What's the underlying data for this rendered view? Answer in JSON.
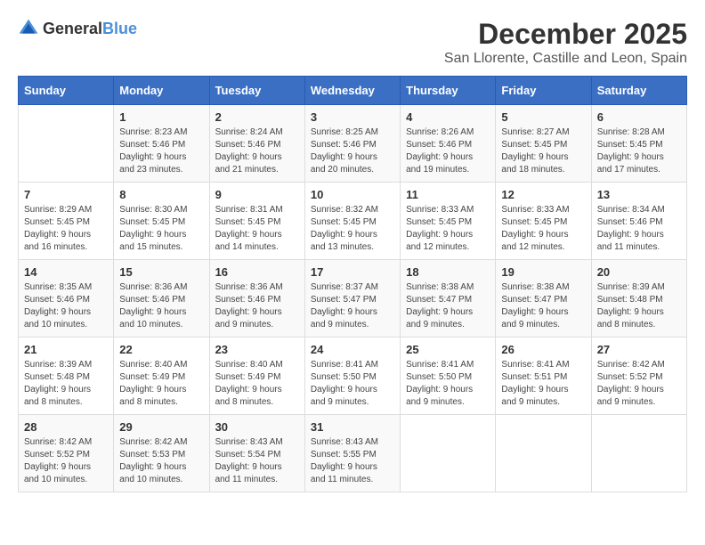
{
  "header": {
    "logo_general": "General",
    "logo_blue": "Blue",
    "month": "December 2025",
    "location": "San Llorente, Castille and Leon, Spain"
  },
  "calendar": {
    "days_of_week": [
      "Sunday",
      "Monday",
      "Tuesday",
      "Wednesday",
      "Thursday",
      "Friday",
      "Saturday"
    ],
    "weeks": [
      [
        {
          "day": "",
          "info": ""
        },
        {
          "day": "1",
          "info": "Sunrise: 8:23 AM\nSunset: 5:46 PM\nDaylight: 9 hours\nand 23 minutes."
        },
        {
          "day": "2",
          "info": "Sunrise: 8:24 AM\nSunset: 5:46 PM\nDaylight: 9 hours\nand 21 minutes."
        },
        {
          "day": "3",
          "info": "Sunrise: 8:25 AM\nSunset: 5:46 PM\nDaylight: 9 hours\nand 20 minutes."
        },
        {
          "day": "4",
          "info": "Sunrise: 8:26 AM\nSunset: 5:46 PM\nDaylight: 9 hours\nand 19 minutes."
        },
        {
          "day": "5",
          "info": "Sunrise: 8:27 AM\nSunset: 5:45 PM\nDaylight: 9 hours\nand 18 minutes."
        },
        {
          "day": "6",
          "info": "Sunrise: 8:28 AM\nSunset: 5:45 PM\nDaylight: 9 hours\nand 17 minutes."
        }
      ],
      [
        {
          "day": "7",
          "info": "Sunrise: 8:29 AM\nSunset: 5:45 PM\nDaylight: 9 hours\nand 16 minutes."
        },
        {
          "day": "8",
          "info": "Sunrise: 8:30 AM\nSunset: 5:45 PM\nDaylight: 9 hours\nand 15 minutes."
        },
        {
          "day": "9",
          "info": "Sunrise: 8:31 AM\nSunset: 5:45 PM\nDaylight: 9 hours\nand 14 minutes."
        },
        {
          "day": "10",
          "info": "Sunrise: 8:32 AM\nSunset: 5:45 PM\nDaylight: 9 hours\nand 13 minutes."
        },
        {
          "day": "11",
          "info": "Sunrise: 8:33 AM\nSunset: 5:45 PM\nDaylight: 9 hours\nand 12 minutes."
        },
        {
          "day": "12",
          "info": "Sunrise: 8:33 AM\nSunset: 5:45 PM\nDaylight: 9 hours\nand 12 minutes."
        },
        {
          "day": "13",
          "info": "Sunrise: 8:34 AM\nSunset: 5:46 PM\nDaylight: 9 hours\nand 11 minutes."
        }
      ],
      [
        {
          "day": "14",
          "info": "Sunrise: 8:35 AM\nSunset: 5:46 PM\nDaylight: 9 hours\nand 10 minutes."
        },
        {
          "day": "15",
          "info": "Sunrise: 8:36 AM\nSunset: 5:46 PM\nDaylight: 9 hours\nand 10 minutes."
        },
        {
          "day": "16",
          "info": "Sunrise: 8:36 AM\nSunset: 5:46 PM\nDaylight: 9 hours\nand 9 minutes."
        },
        {
          "day": "17",
          "info": "Sunrise: 8:37 AM\nSunset: 5:47 PM\nDaylight: 9 hours\nand 9 minutes."
        },
        {
          "day": "18",
          "info": "Sunrise: 8:38 AM\nSunset: 5:47 PM\nDaylight: 9 hours\nand 9 minutes."
        },
        {
          "day": "19",
          "info": "Sunrise: 8:38 AM\nSunset: 5:47 PM\nDaylight: 9 hours\nand 9 minutes."
        },
        {
          "day": "20",
          "info": "Sunrise: 8:39 AM\nSunset: 5:48 PM\nDaylight: 9 hours\nand 8 minutes."
        }
      ],
      [
        {
          "day": "21",
          "info": "Sunrise: 8:39 AM\nSunset: 5:48 PM\nDaylight: 9 hours\nand 8 minutes."
        },
        {
          "day": "22",
          "info": "Sunrise: 8:40 AM\nSunset: 5:49 PM\nDaylight: 9 hours\nand 8 minutes."
        },
        {
          "day": "23",
          "info": "Sunrise: 8:40 AM\nSunset: 5:49 PM\nDaylight: 9 hours\nand 8 minutes."
        },
        {
          "day": "24",
          "info": "Sunrise: 8:41 AM\nSunset: 5:50 PM\nDaylight: 9 hours\nand 9 minutes."
        },
        {
          "day": "25",
          "info": "Sunrise: 8:41 AM\nSunset: 5:50 PM\nDaylight: 9 hours\nand 9 minutes."
        },
        {
          "day": "26",
          "info": "Sunrise: 8:41 AM\nSunset: 5:51 PM\nDaylight: 9 hours\nand 9 minutes."
        },
        {
          "day": "27",
          "info": "Sunrise: 8:42 AM\nSunset: 5:52 PM\nDaylight: 9 hours\nand 9 minutes."
        }
      ],
      [
        {
          "day": "28",
          "info": "Sunrise: 8:42 AM\nSunset: 5:52 PM\nDaylight: 9 hours\nand 10 minutes."
        },
        {
          "day": "29",
          "info": "Sunrise: 8:42 AM\nSunset: 5:53 PM\nDaylight: 9 hours\nand 10 minutes."
        },
        {
          "day": "30",
          "info": "Sunrise: 8:43 AM\nSunset: 5:54 PM\nDaylight: 9 hours\nand 11 minutes."
        },
        {
          "day": "31",
          "info": "Sunrise: 8:43 AM\nSunset: 5:55 PM\nDaylight: 9 hours\nand 11 minutes."
        },
        {
          "day": "",
          "info": ""
        },
        {
          "day": "",
          "info": ""
        },
        {
          "day": "",
          "info": ""
        }
      ]
    ]
  }
}
